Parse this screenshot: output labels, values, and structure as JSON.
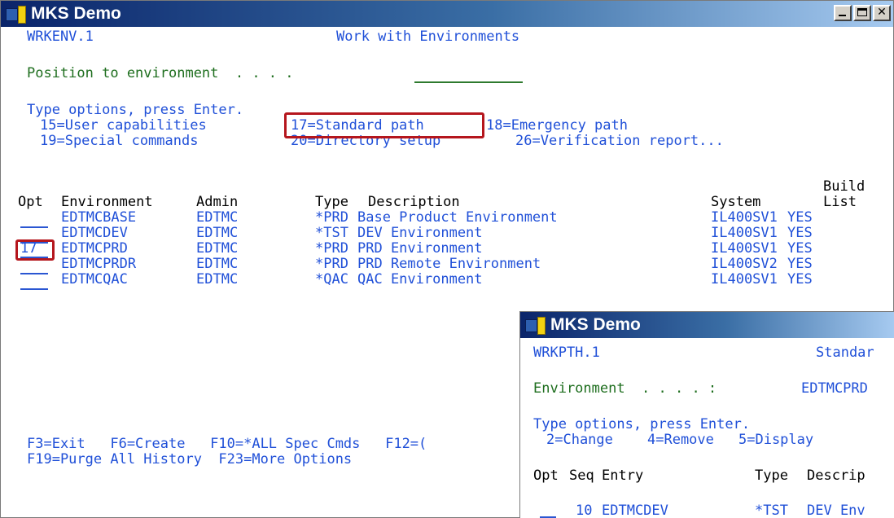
{
  "win1": {
    "title": "MKS Demo",
    "screen_id": "WRKENV.1",
    "screen_title": "Work with Environments",
    "position_prompt": "Position to environment  . . . .",
    "options_header": "Type options, press Enter.",
    "options_line1": [
      "15=User capabilities",
      "17=Standard path",
      "18=Emergency path"
    ],
    "options_line2": [
      "19=Special commands",
      "20=Directory setup",
      "26=Verification report..."
    ],
    "columns": {
      "opt": "Opt",
      "environment": "Environment",
      "admin": "Admin",
      "type": "Type",
      "description": "Description",
      "system": "System",
      "build": "Build",
      "list": "List"
    },
    "rows": [
      {
        "opt": "",
        "environment": "EDTMCBASE",
        "admin": "EDTMC",
        "type": "*PRD",
        "description": "Base Product Environment",
        "system": "IL400SV1",
        "build": "YES"
      },
      {
        "opt": "",
        "environment": "EDTMCDEV",
        "admin": "EDTMC",
        "type": "*TST",
        "description": "DEV Environment",
        "system": "IL400SV1",
        "build": "YES"
      },
      {
        "opt": "17",
        "environment": "EDTMCPRD",
        "admin": "EDTMC",
        "type": "*PRD",
        "description": "PRD Environment",
        "system": "IL400SV1",
        "build": "YES"
      },
      {
        "opt": "",
        "environment": "EDTMCPRDR",
        "admin": "EDTMC",
        "type": "*PRD",
        "description": "PRD Remote Environment",
        "system": "IL400SV2",
        "build": "YES"
      },
      {
        "opt": "",
        "environment": "EDTMCQAC",
        "admin": "EDTMC",
        "type": "*QAC",
        "description": "QAC Environment",
        "system": "IL400SV1",
        "build": "YES"
      }
    ],
    "fkeys1": "F3=Exit   F6=Create   F10=*ALL Spec Cmds   F12=(",
    "fkeys2": "F19=Purge All History  F23=More Options"
  },
  "win2": {
    "title": "MKS Demo",
    "screen_id": "WRKPTH.1",
    "screen_title": "Standar",
    "env_label": "Environment  . . . . :",
    "env_value": "EDTMCPRD",
    "options_header": "Type options, press Enter.",
    "options_line": [
      "2=Change",
      "4=Remove",
      "5=Display"
    ],
    "columns": {
      "opt": "Opt",
      "seq": "Seq",
      "entry": "Entry",
      "type": "Type",
      "description": "Descrip"
    },
    "row_partial": {
      "seq": "10",
      "entry": "EDTMCDEV",
      "type": "*TST",
      "description": "DEV Env"
    }
  }
}
